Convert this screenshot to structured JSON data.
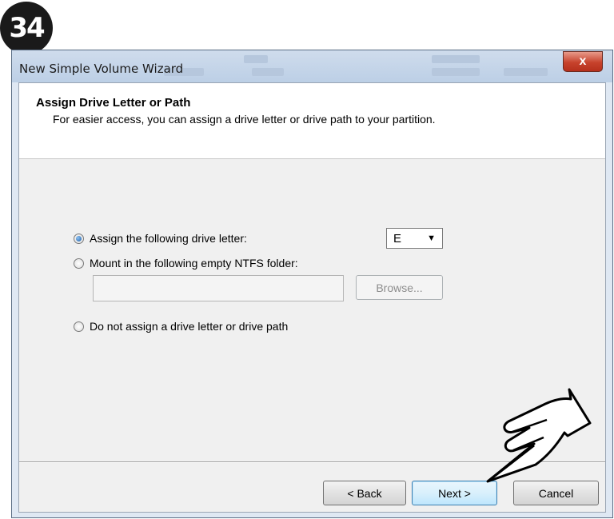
{
  "step_number": "34",
  "window": {
    "title": "New Simple Volume Wizard",
    "close_label": "x"
  },
  "header": {
    "title": "Assign Drive Letter or Path",
    "subtitle": "For easier access, you can assign a drive letter or drive path to your partition."
  },
  "options": {
    "assign_letter": {
      "label": "Assign the following drive letter:",
      "selected": true
    },
    "mount_folder": {
      "label": "Mount in the following empty NTFS folder:",
      "selected": false
    },
    "no_letter": {
      "label": "Do not assign a drive letter or drive path",
      "selected": false
    }
  },
  "drive_letter_select": {
    "value": "E"
  },
  "folder_path": {
    "value": ""
  },
  "buttons": {
    "browse": "Browse...",
    "back": "< Back",
    "next": "Next >",
    "cancel": "Cancel"
  },
  "icons": {
    "pointer": "pointing-hand-icon",
    "close": "close-icon"
  }
}
